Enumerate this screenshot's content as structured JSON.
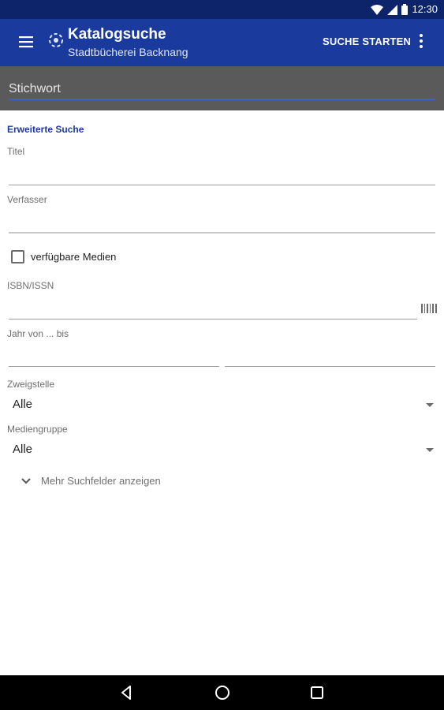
{
  "status_bar": {
    "time": "12:30",
    "icons": [
      "wifi-icon",
      "signal-icon",
      "battery-icon"
    ]
  },
  "app_bar": {
    "title": "Katalogsuche",
    "subtitle": "Stadtbücherei Backnang",
    "action_label": "SUCHE STARTEN",
    "icons": [
      "menu-icon",
      "library-logo-icon",
      "more-vert-icon"
    ]
  },
  "search": {
    "placeholder": "Stichwort",
    "value": ""
  },
  "form": {
    "section_title": "Erweiterte Suche",
    "title_label": "Titel",
    "author_label": "Verfasser",
    "available_label": "verfügbare Medien",
    "available_checked": false,
    "isbn_label": "ISBN/ISSN",
    "year_label": "Jahr von ... bis",
    "branch_label": "Zweigstelle",
    "branch_value": "Alle",
    "media_group_label": "Mediengruppe",
    "media_group_value": "Alle",
    "more_fields_label": "Mehr Suchfelder anzeigen"
  },
  "nav_bar": {
    "icons": [
      "back-icon",
      "home-icon",
      "recents-icon"
    ]
  },
  "colors": {
    "status_bar": "#0d246b",
    "app_bar": "#1a3a9e",
    "search_bar": "#5a5a5a",
    "accent": "#3f5fc4"
  }
}
